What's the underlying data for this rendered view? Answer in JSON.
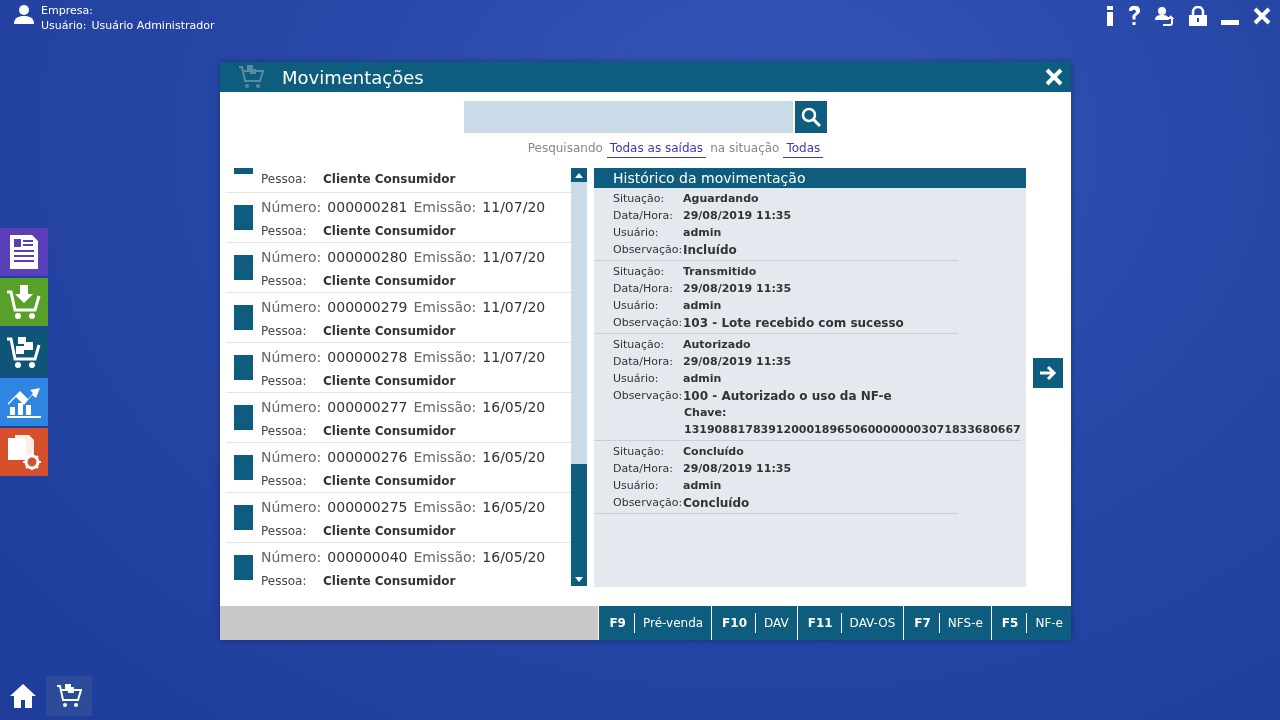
{
  "session": {
    "company_label": "Empresa:",
    "user_label": "Usuário:",
    "user": "Usuário Administrador"
  },
  "dialog": {
    "title": "Movimentações",
    "filter": {
      "prefix": "Pesquisando",
      "scope": "Todas as saídas",
      "middle": "na situação",
      "status": "Todas"
    },
    "movements": [
      {
        "person_label": "Pessoa:",
        "person": "Cliente Consumidor"
      },
      {
        "number_label": "Número:",
        "number": "000000281",
        "date_label": "Emissão:",
        "date": "11/07/20",
        "person_label": "Pessoa:",
        "person": "Cliente Consumidor"
      },
      {
        "number_label": "Número:",
        "number": "000000280",
        "date_label": "Emissão:",
        "date": "11/07/20",
        "person_label": "Pessoa:",
        "person": "Cliente Consumidor"
      },
      {
        "number_label": "Número:",
        "number": "000000279",
        "date_label": "Emissão:",
        "date": "11/07/20",
        "person_label": "Pessoa:",
        "person": "Cliente Consumidor"
      },
      {
        "number_label": "Número:",
        "number": "000000278",
        "date_label": "Emissão:",
        "date": "11/07/20",
        "person_label": "Pessoa:",
        "person": "Cliente Consumidor"
      },
      {
        "number_label": "Número:",
        "number": "000000277",
        "date_label": "Emissão:",
        "date": "16/05/20",
        "person_label": "Pessoa:",
        "person": "Cliente Consumidor"
      },
      {
        "number_label": "Número:",
        "number": "000000276",
        "date_label": "Emissão:",
        "date": "16/05/20",
        "person_label": "Pessoa:",
        "person": "Cliente Consumidor"
      },
      {
        "number_label": "Número:",
        "number": "000000275",
        "date_label": "Emissão:",
        "date": "16/05/20",
        "person_label": "Pessoa:",
        "person": "Cliente Consumidor"
      },
      {
        "number_label": "Número:",
        "number": "000000040",
        "date_label": "Emissão:",
        "date": "16/05/20",
        "person_label": "Pessoa:",
        "person": "Cliente Consumidor"
      }
    ],
    "history": {
      "title": "Histórico da movimentação",
      "entries": [
        {
          "fields": [
            {
              "label": "Situação:",
              "value": "Aguardando"
            },
            {
              "label": "Data/Hora:",
              "value": "29/08/2019 11:35"
            },
            {
              "label": "Usuário:",
              "value": "admin"
            },
            {
              "label": "Observação:",
              "value": "Incluído"
            }
          ]
        },
        {
          "fields": [
            {
              "label": "Situação:",
              "value": "Transmitido"
            },
            {
              "label": "Data/Hora:",
              "value": "29/08/2019 11:35"
            },
            {
              "label": "Usuário:",
              "value": "admin"
            },
            {
              "label": "Observação:",
              "value": "103 - Lote recebido com sucesso"
            }
          ]
        },
        {
          "fields": [
            {
              "label": "Situação:",
              "value": "Autorizado"
            },
            {
              "label": "Data/Hora:",
              "value": "29/08/2019 11:35"
            },
            {
              "label": "Usuário:",
              "value": "admin"
            },
            {
              "label": "Observação:",
              "value": "100 - Autorizado o uso da NF-e",
              "extra": [
                "Chave:",
                "13190881783912000189650600000003071833680667"
              ]
            }
          ]
        },
        {
          "fields": [
            {
              "label": "Situação:",
              "value": "Concluído"
            },
            {
              "label": "Data/Hora:",
              "value": "29/08/2019 11:35"
            },
            {
              "label": "Usuário:",
              "value": "admin"
            },
            {
              "label": "Observação:",
              "value": "Concluído"
            }
          ]
        }
      ]
    },
    "function_keys": [
      {
        "key": "F9",
        "label": "Pré-venda"
      },
      {
        "key": "F10",
        "label": "DAV"
      },
      {
        "key": "F11",
        "label": "DAV-OS"
      },
      {
        "key": "F7",
        "label": "NFS-e"
      },
      {
        "key": "F5",
        "label": "NF-e"
      }
    ]
  },
  "tiles": [
    {
      "kind": "document",
      "color": "#5a3fb8"
    },
    {
      "kind": "cart-download",
      "color": "#57a12a"
    },
    {
      "kind": "cart-boxes",
      "color": "#0e5577"
    },
    {
      "kind": "chart",
      "color": "#2f86e0"
    },
    {
      "kind": "documents-gear",
      "color": "#d5502a"
    }
  ]
}
